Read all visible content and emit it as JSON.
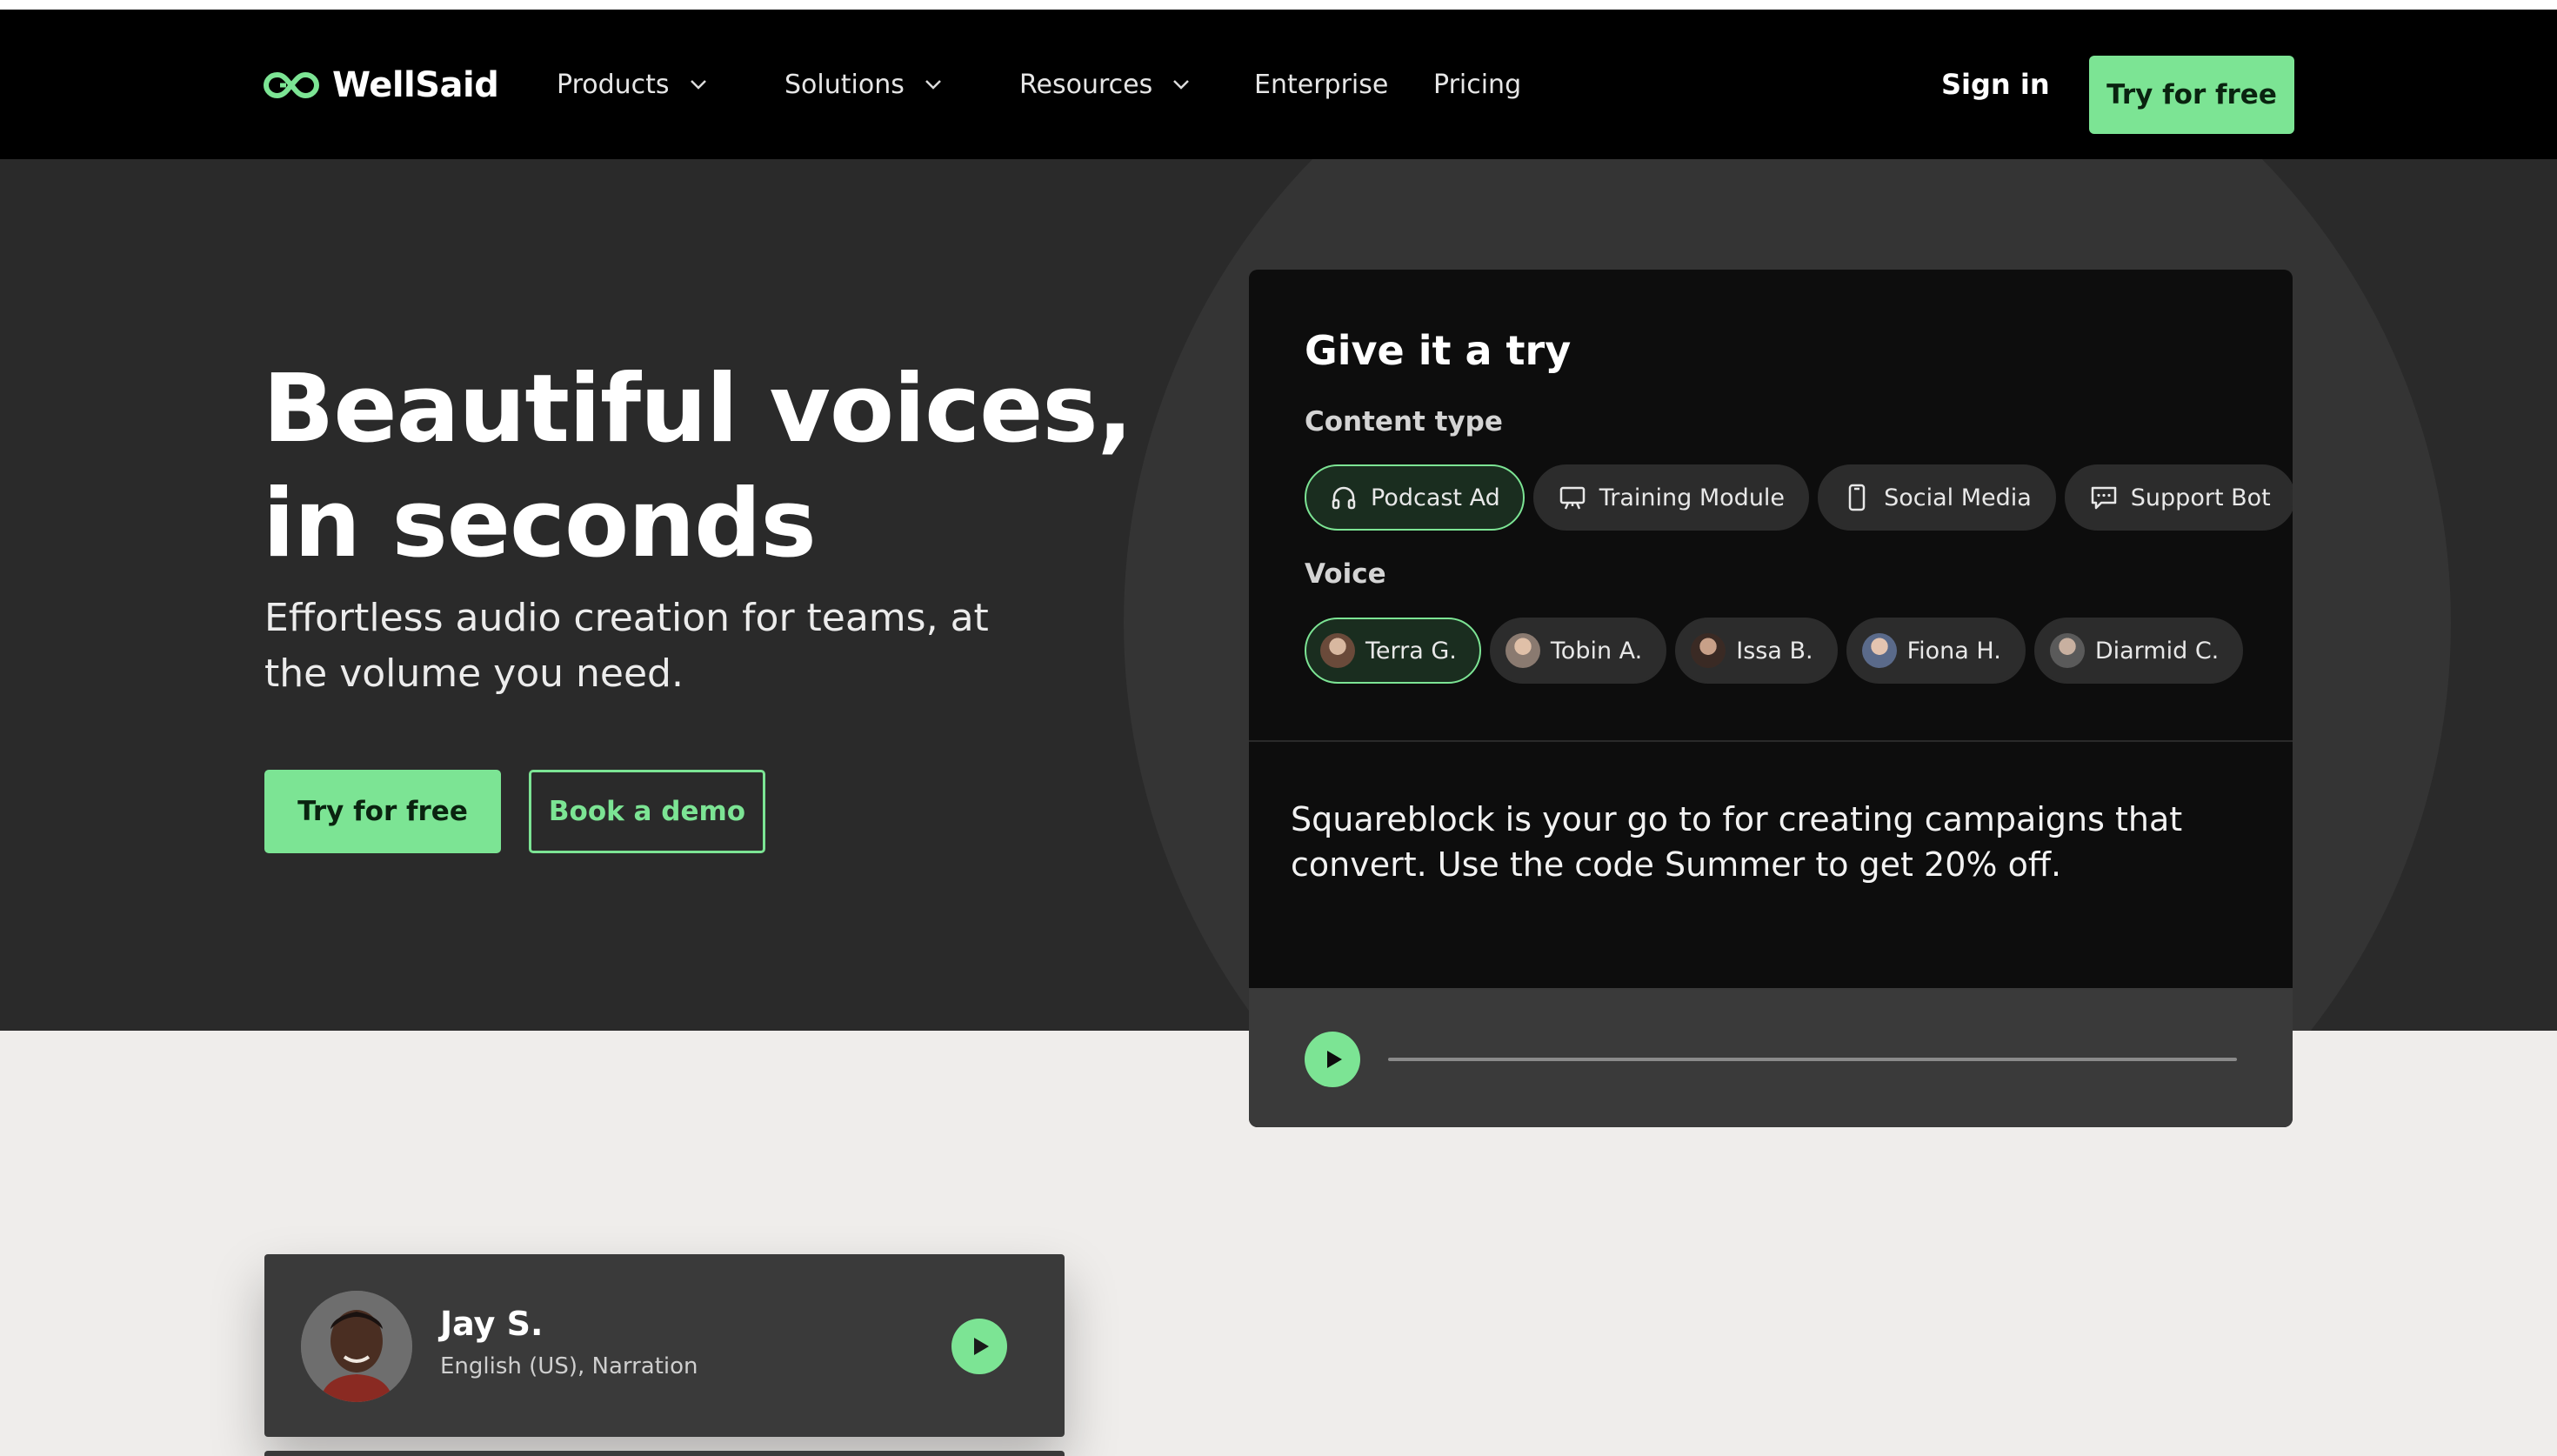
{
  "brand": {
    "name": "WellSaid",
    "accent": "#7ce494"
  },
  "nav": {
    "items": [
      {
        "label": "Products",
        "dropdown": true
      },
      {
        "label": "Solutions",
        "dropdown": true
      },
      {
        "label": "Resources",
        "dropdown": true
      },
      {
        "label": "Enterprise",
        "dropdown": false
      },
      {
        "label": "Pricing",
        "dropdown": false
      }
    ],
    "sign_in": "Sign in",
    "cta": "Try for free"
  },
  "hero": {
    "title_line1": "Beautiful voices,",
    "title_line2": "in seconds",
    "subtitle": "Effortless audio creation for teams, at the volume you need.",
    "primary_cta": "Try for free",
    "secondary_cta": "Book a demo"
  },
  "demo": {
    "title": "Give it a try",
    "content_type_label": "Content type",
    "content_types": [
      {
        "label": "Podcast Ad",
        "icon": "headphones-icon",
        "active": true
      },
      {
        "label": "Training Module",
        "icon": "presentation-icon",
        "active": false
      },
      {
        "label": "Social Media",
        "icon": "phone-icon",
        "active": false
      },
      {
        "label": "Support Bot",
        "icon": "chat-icon",
        "active": false
      }
    ],
    "voice_label": "Voice",
    "voices": [
      {
        "label": "Terra G.",
        "active": true
      },
      {
        "label": "Tobin A.",
        "active": false
      },
      {
        "label": "Issa B.",
        "active": false
      },
      {
        "label": "Fiona H.",
        "active": false
      },
      {
        "label": "Diarmid C.",
        "active": false
      }
    ],
    "script_text": "Squareblock is your go to for creating campaigns that convert. Use the code Summer to get 20% off.",
    "progress": 0
  },
  "voice_card": {
    "name": "Jay S.",
    "meta": "English (US), Narration"
  }
}
